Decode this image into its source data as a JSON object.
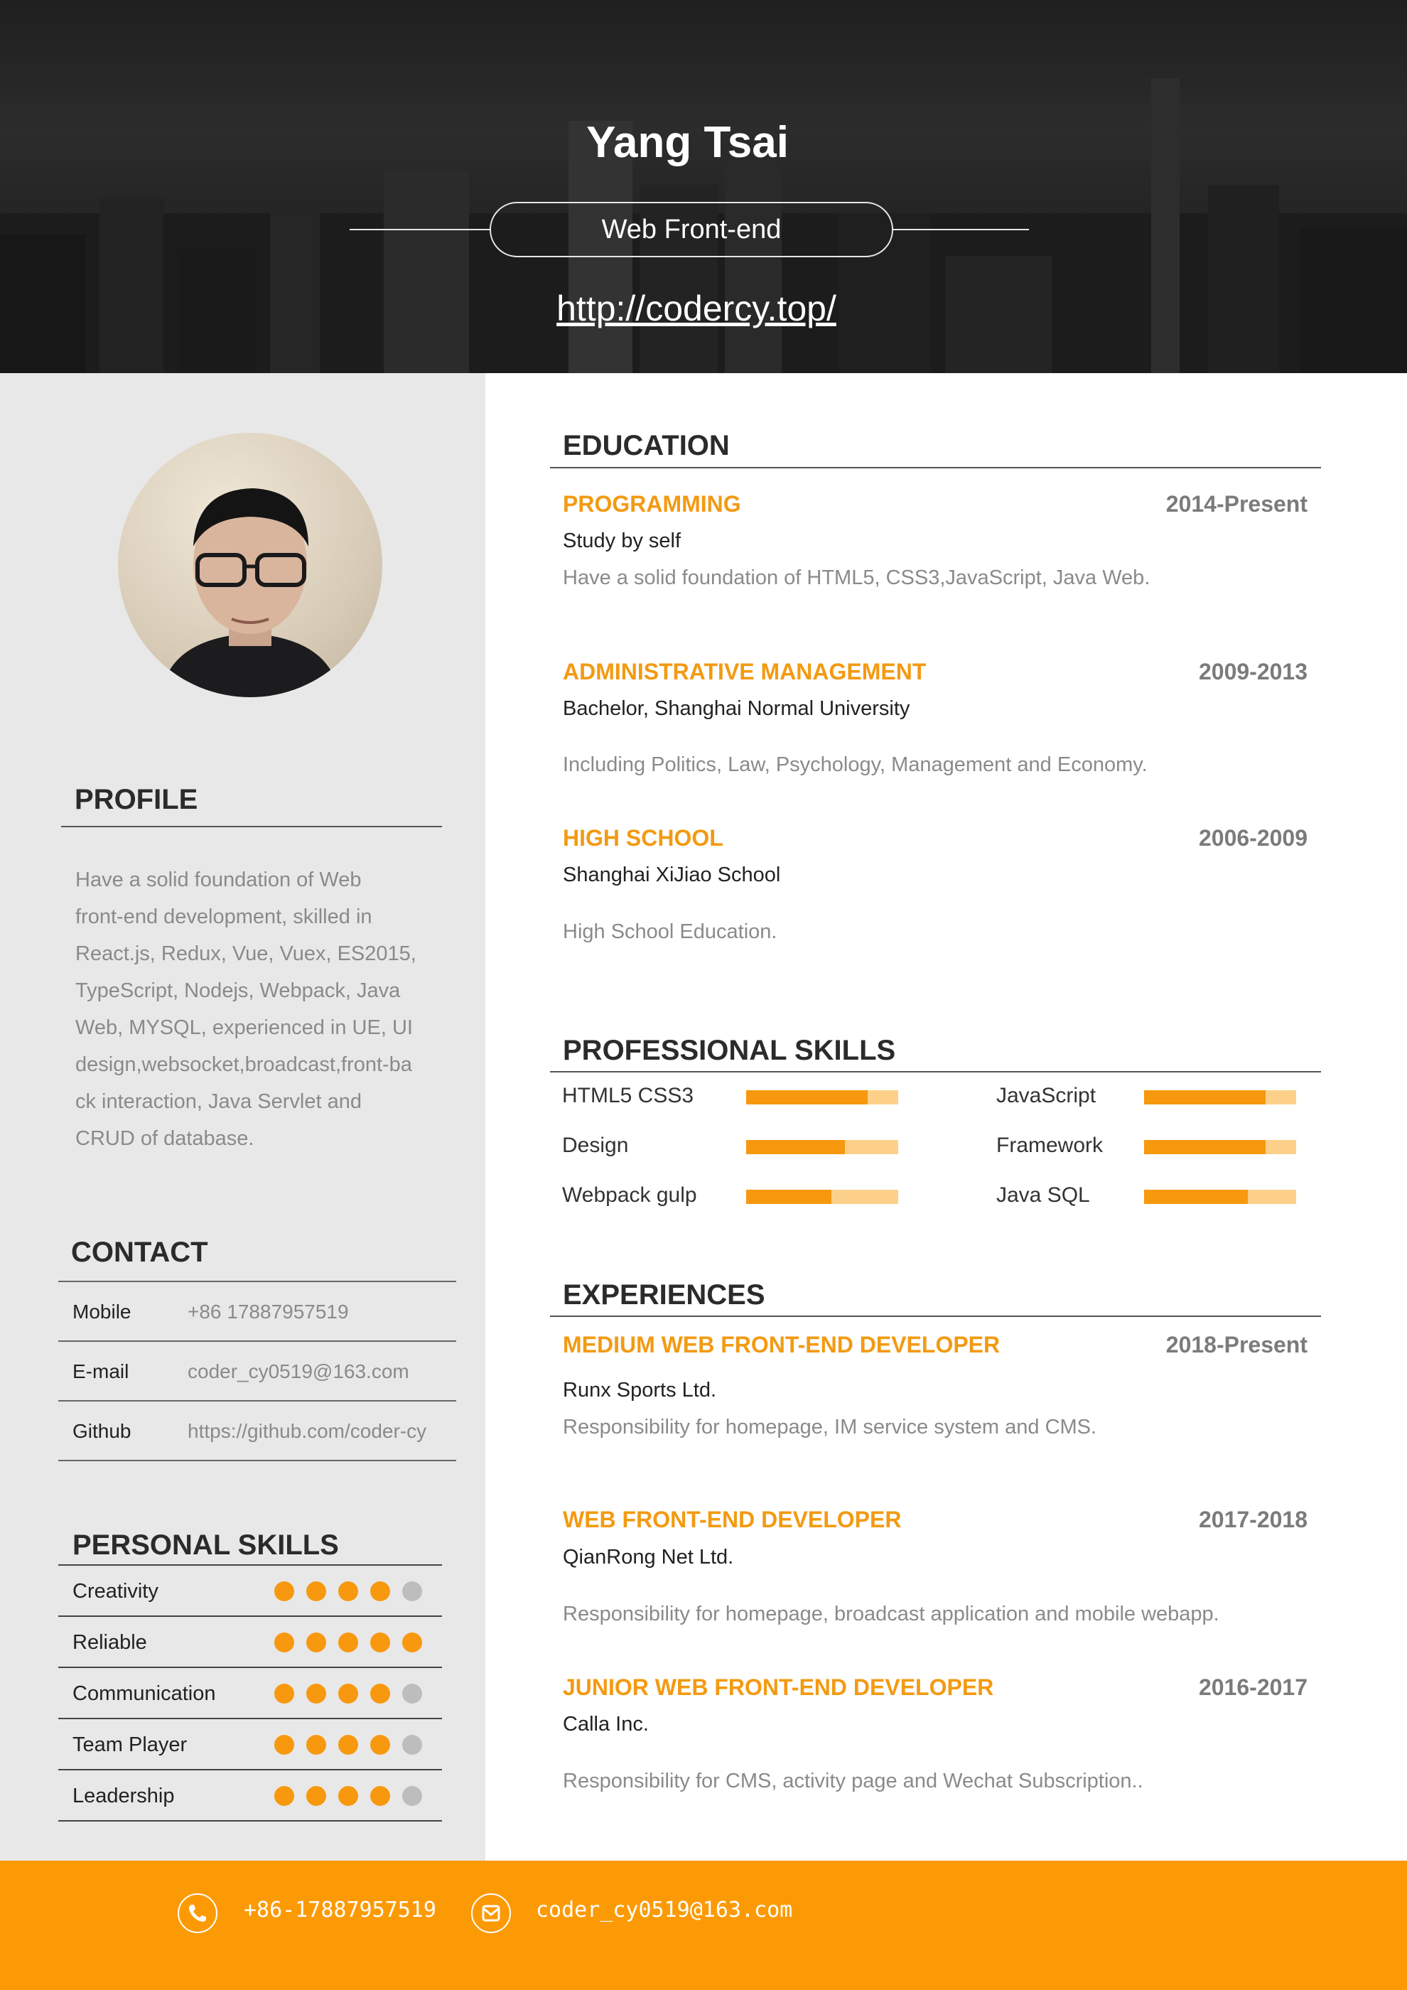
{
  "header": {
    "name": "Yang Tsai",
    "role": "Web Front-end",
    "website": "http://codercy.top/"
  },
  "colors": {
    "accent": "#f7980e",
    "accent_light": "#fdd08a",
    "dot_off": "#bdbdbd",
    "sidebar_bg": "#e8e8e8"
  },
  "sidebar": {
    "profile": {
      "title": "PROFILE",
      "lines": [
        "Have a solid foundation of Web",
        "front-end development, skilled in",
        "React.js, Redux, Vue, Vuex, ES2015,",
        "TypeScript, Nodejs, Webpack, Java",
        "Web, MYSQL, experienced in UE, UI",
        "design,websocket,broadcast,front-ba",
        "ck interaction, Java Servlet and",
        "CRUD of database."
      ]
    },
    "contact": {
      "title": "CONTACT",
      "rows": [
        {
          "label": "Mobile",
          "value": "+86 17887957519"
        },
        {
          "label": "E-mail",
          "value": "coder_cy0519@163.com"
        },
        {
          "label": "Github",
          "value": "https://github.com/coder-cy"
        }
      ]
    },
    "personal_skills": {
      "title": "PERSONAL SKILLS",
      "max": 5,
      "items": [
        {
          "name": "Creativity",
          "rating": 4
        },
        {
          "name": "Reliable",
          "rating": 5
        },
        {
          "name": "Communication",
          "rating": 4
        },
        {
          "name": "Team Player",
          "rating": 4
        },
        {
          "name": "Leadership",
          "rating": 4
        }
      ]
    }
  },
  "education": {
    "title": "EDUCATION",
    "items": [
      {
        "title": "PROGRAMMING",
        "date": "2014-Present",
        "subtitle": "Study by self",
        "desc": "Have a solid foundation of HTML5, CSS3,JavaScript, Java Web."
      },
      {
        "title": "ADMINISTRATIVE MANAGEMENT",
        "date": "2009-2013",
        "subtitle": "Bachelor, Shanghai Normal University",
        "desc": "Including Politics, Law, Psychology, Management and Economy."
      },
      {
        "title": "HIGH SCHOOL",
        "date": "2006-2009",
        "subtitle": "Shanghai XiJiao School",
        "desc": "High School Education."
      }
    ]
  },
  "professional_skills": {
    "title": "PROFESSIONAL SKILLS",
    "items": [
      {
        "name": "HTML5 CSS3",
        "level": 0.8
      },
      {
        "name": "JavaScript",
        "level": 0.8
      },
      {
        "name": "Design",
        "level": 0.65
      },
      {
        "name": "Framework",
        "level": 0.8
      },
      {
        "name": "Webpack gulp",
        "level": 0.56
      },
      {
        "name": "Java SQL",
        "level": 0.68
      }
    ]
  },
  "experiences": {
    "title": "EXPERIENCES",
    "items": [
      {
        "title": "MEDIUM WEB FRONT-END DEVELOPER",
        "date": "2018-Present",
        "subtitle": "Runx Sports Ltd.",
        "desc": "Responsibility for homepage, IM service system and CMS."
      },
      {
        "title": "WEB FRONT-END DEVELOPER",
        "date": "2017-2018",
        "subtitle": "QianRong Net Ltd.",
        "desc": "Responsibility for homepage, broadcast application and mobile webapp."
      },
      {
        "title": "JUNIOR WEB FRONT-END DEVELOPER",
        "date": "2016-2017",
        "subtitle": "Calla Inc.",
        "desc": "Responsibility for CMS, activity page and Wechat Subscription.."
      }
    ]
  },
  "footer": {
    "phone": "+86-17887957519",
    "email": "coder_cy0519@163.com",
    "phone_icon": "phone-icon",
    "email_icon": "mail-icon"
  }
}
